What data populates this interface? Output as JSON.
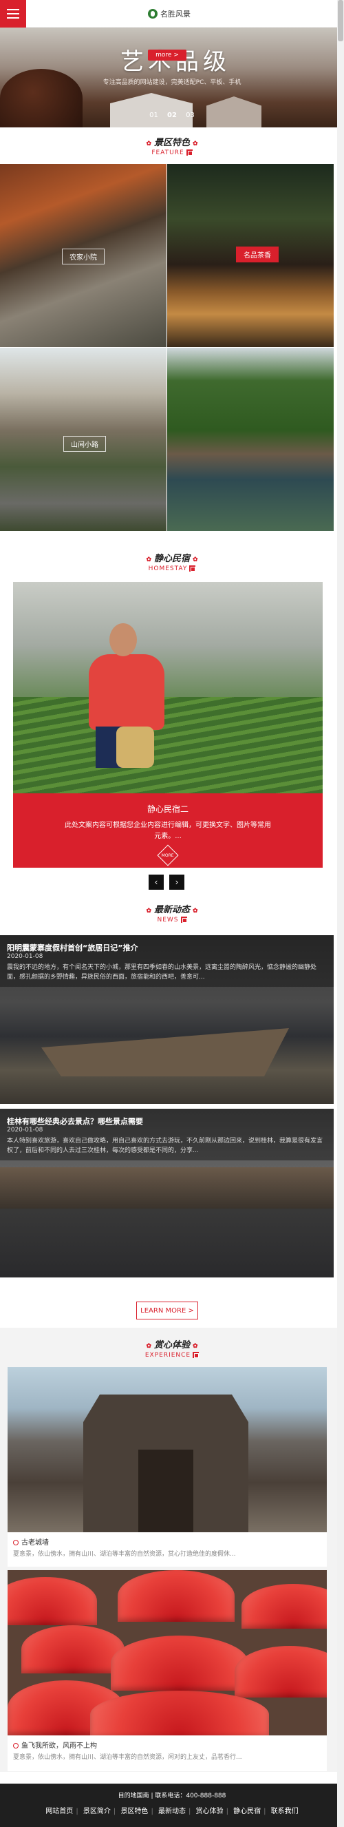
{
  "header": {
    "logo_text": "名胜风景"
  },
  "banner": {
    "title": "艺术品级",
    "more": "more >",
    "subtitle": "专注高品质的网站建设，完美适配PC、平板、手机",
    "dots": [
      "01",
      "02",
      "03"
    ]
  },
  "feature": {
    "title_cn": "景区特色",
    "title_en": "FEATURE",
    "items": [
      {
        "label": "农家小院"
      },
      {
        "label": "名品茶香"
      },
      {
        "label": "山间小路"
      },
      {
        "label": ""
      }
    ]
  },
  "homestay": {
    "title_cn": "静心民宿",
    "title_en": "HOMESTAY",
    "card_title": "静心民宿二",
    "card_desc": "此处文案内容可根据您企业内容进行编辑，可更换文字、图片等常用元素。...",
    "more_icon": "MORE",
    "prev": "‹",
    "next": "›"
  },
  "news": {
    "title_cn": "最新动态",
    "title_en": "NEWS",
    "items": [
      {
        "title": "阳明震蒙寨度假村首创“旅居日记”推介",
        "date": "2020-01-08",
        "excerpt": "震我的不远的地方，有个闻名天下的小城，那里有四季如春的山水美景，远离尘嚣的陶醉风光，惦念静谧的幽静处面，感孔颜据的乡野情趣，异族民俗的西面，旅宿能和的西吧，善意可..."
      },
      {
        "title": "桂林有哪些经典必去景点？哪些景点需要",
        "date": "2020-01-08",
        "excerpt": "本人特别喜欢旅游，喜欢自己做攻略，用自己喜欢的方式去游玩，不久前刚从那边回来，说到桂林，我算是很有发言权了，前后和不同的人去过三次桂林，每次的感受都是不同的，分享..."
      }
    ],
    "learn_more": "LEARN MORE >"
  },
  "experience": {
    "title_cn": "赏心体验",
    "title_en": "EXPERIENCE",
    "items": [
      {
        "title": "古老城墙",
        "desc": "夏意景，依山傍水，拥有山川、湖泊等丰富的自然资源，赏心打造绝佳的度假休..."
      },
      {
        "title": "鱼飞我所欲，风雨不上构",
        "desc": "夏意景，依山傍水，拥有山川、湖泊等丰富的自然资源，闲对的上友丈，品茗香行..."
      }
    ]
  },
  "footer": {
    "contact": "目的地国南  |  联系电话：400-888-888",
    "links": [
      "网站首页",
      "景区简介",
      "景区特色",
      "最新动态",
      "赏心体验",
      "静心民宿",
      "联系我们"
    ]
  }
}
